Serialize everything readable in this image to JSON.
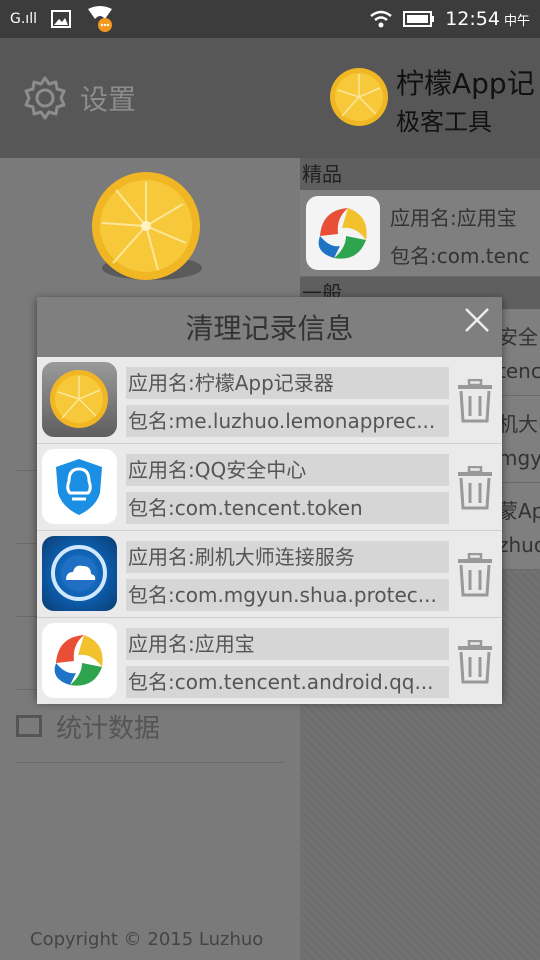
{
  "status_bar": {
    "signal": "G.ıll",
    "time": "12:54",
    "ampm": "中午"
  },
  "drawer": {
    "title": "设置",
    "copyright": "Copyright © 2015 Luzhuo",
    "menu_items": [
      "",
      "",
      "",
      "",
      "统计数据"
    ]
  },
  "main": {
    "app_title": "柠檬App记",
    "app_subtitle": "极客工具",
    "section_featured": "精品",
    "section_general": "一般",
    "rows": [
      {
        "name": "应用名:应用宝",
        "pkg": "包名:com.tenc"
      },
      {
        "name": "安全",
        "pkg": "tenc"
      },
      {
        "name": "机大师",
        "pkg": "mgy"
      },
      {
        "name": "蒙Ap",
        "pkg": "zhuo"
      }
    ]
  },
  "dialog": {
    "title": "清理记录信息",
    "items": [
      {
        "name": "应用名:柠檬App记录器",
        "pkg": "包名:me.luzhuo.lemonapprec..."
      },
      {
        "name": "应用名:QQ安全中心",
        "pkg": "包名:com.tencent.token"
      },
      {
        "name": "应用名:刷机大师连接服务",
        "pkg": "包名:com.mgyun.shua.protec..."
      },
      {
        "name": "应用名:应用宝",
        "pkg": "包名:com.tencent.android.qq..."
      }
    ]
  },
  "colors": {
    "dialog_bg": "#e9e9e9",
    "dialog_header": "#7f7f7f",
    "field_bg": "#d6d6d6"
  }
}
